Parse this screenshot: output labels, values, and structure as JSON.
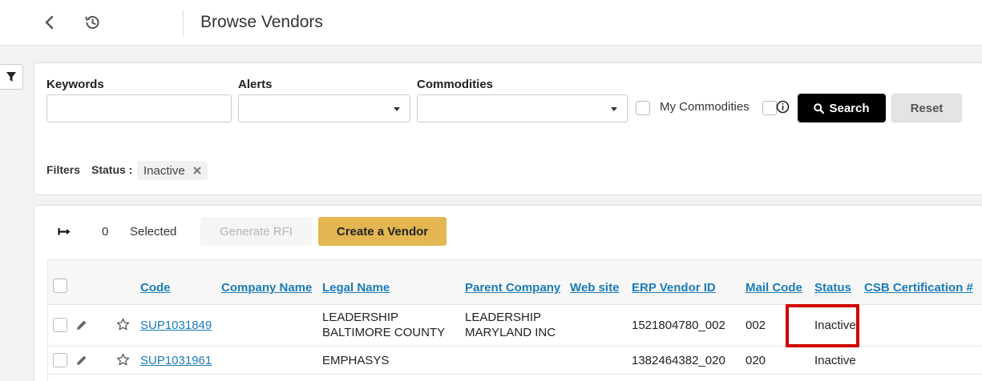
{
  "page": {
    "title": "Browse Vendors"
  },
  "search": {
    "keywords_label": "Keywords",
    "keywords_value": "",
    "alerts_label": "Alerts",
    "commodities_label": "Commodities",
    "my_commodities_label": "My Commodities",
    "search_label": "Search",
    "reset_label": "Reset",
    "filters_label": "Filters",
    "status_filter_label": "Status :",
    "status_filter_value": "Inactive"
  },
  "results": {
    "selected_count": "0",
    "selected_label": "Selected",
    "generate_rfi_label": "Generate RFI",
    "create_vendor_label": "Create a Vendor",
    "columns": [
      "Code",
      "Company Name",
      "Legal Name",
      "Parent Company",
      "Web site",
      "ERP Vendor ID",
      "Mail Code",
      "Status",
      "CSB Certification #"
    ],
    "rows": [
      {
        "code": "SUP1031849",
        "company_name": "",
        "legal_name_1": "LEADERSHIP",
        "legal_name_2": "BALTIMORE COUNTY",
        "parent_company_1": "LEADERSHIP",
        "parent_company_2": "MARYLAND INC",
        "web_site": "",
        "erp_vendor_id": "1521804780_002",
        "mail_code": "002",
        "status": "Inactive",
        "csb_certification": ""
      },
      {
        "code": "SUP1031961",
        "company_name": "",
        "legal_name": "EMPHASYS",
        "parent_company": "",
        "web_site": "",
        "erp_vendor_id": "1382464382_020",
        "mail_code": "020",
        "status": "Inactive",
        "csb_certification": ""
      }
    ]
  },
  "colors": {
    "link": "#1a7bb9",
    "primary_button": "#000000",
    "create_button": "#e3b651",
    "highlight": "#d00000"
  },
  "icons": [
    "chevron-left-icon",
    "history-icon",
    "filter-icon",
    "search-icon",
    "info-icon",
    "expand-arrow-icon",
    "pencil-icon",
    "star-icon",
    "close-icon",
    "chevron-down-icon"
  ]
}
